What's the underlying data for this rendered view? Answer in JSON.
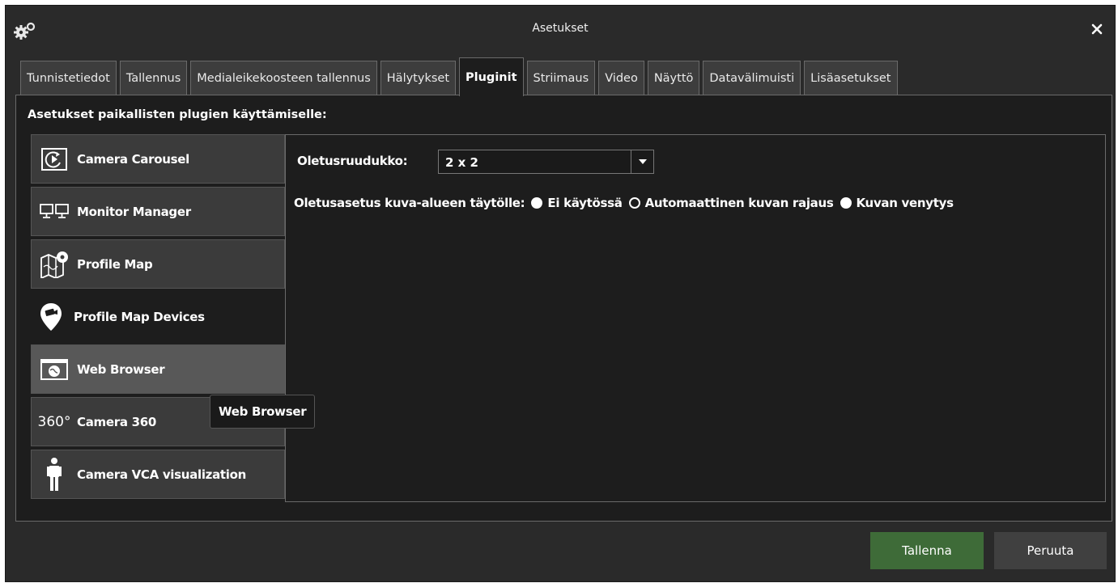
{
  "window": {
    "title": "Asetukset"
  },
  "icons": {
    "settings": "gears-icon",
    "close": "close-icon"
  },
  "tabs": [
    {
      "label": "Tunnistetiedot"
    },
    {
      "label": "Tallennus"
    },
    {
      "label": "Medialeikekoosteen tallennus"
    },
    {
      "label": "Hälytykset"
    },
    {
      "label": "Pluginit",
      "active": true
    },
    {
      "label": "Striimaus"
    },
    {
      "label": "Video"
    },
    {
      "label": "Näyttö"
    },
    {
      "label": "Datavälimuisti"
    },
    {
      "label": "Lisäasetukset"
    }
  ],
  "section_title": "Asetukset paikallisten plugien käyttämiselle:",
  "plugins": [
    {
      "label": "Camera Carousel",
      "icon": "camera-carousel-icon"
    },
    {
      "label": "Monitor Manager",
      "icon": "monitors-icon"
    },
    {
      "label": "Profile Map",
      "icon": "map-icon"
    },
    {
      "label": "Profile Map Devices",
      "icon": "map-pin-camera-icon",
      "selected": true
    },
    {
      "label": "Web Browser",
      "icon": "web-browser-icon",
      "hovered": true
    },
    {
      "label": "Camera 360",
      "icon": "360-icon",
      "icon_text": "360°"
    },
    {
      "label": "Camera VCA visualization",
      "icon": "person-icon"
    }
  ],
  "tooltip": "Web Browser",
  "settings": {
    "grid_label": "Oletusruudukko:",
    "grid_value": "2 x 2",
    "fill_label": "Oletusasetus kuva-alueen täytölle:",
    "fill_options": [
      {
        "label": "Ei käytössä",
        "style": "filled"
      },
      {
        "label": "Automaattinen kuvan rajaus",
        "style": "hollow"
      },
      {
        "label": "Kuvan venytys",
        "style": "filled"
      }
    ]
  },
  "buttons": {
    "save": "Tallenna",
    "cancel": "Peruuta"
  },
  "colors": {
    "save_button": "#3e6b38",
    "background": "#2a2a2a",
    "panel": "#1d1d1d"
  }
}
